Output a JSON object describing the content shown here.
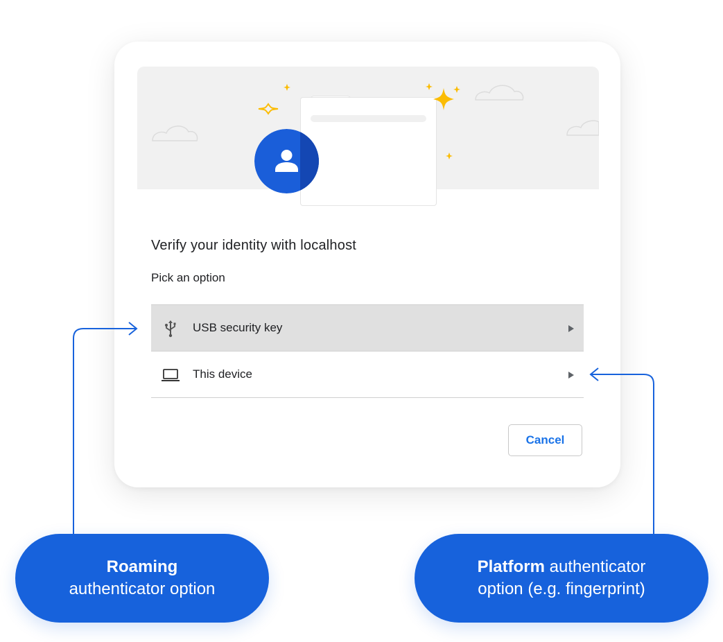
{
  "dialog": {
    "title": "Verify your identity with localhost",
    "subtitle": "Pick an option",
    "options": [
      {
        "label": "USB security key",
        "icon": "usb-icon",
        "highlighted": true
      },
      {
        "label": "This device",
        "icon": "laptop-icon",
        "highlighted": false
      }
    ],
    "cancel_label": "Cancel"
  },
  "callouts": {
    "left": {
      "bold": "Roaming",
      "text": "authenticator option"
    },
    "right": {
      "bold": "Platform",
      "text_inline": " authenticator",
      "text": "option (e.g. fingerprint)"
    }
  },
  "colors": {
    "accent": "#1a73e8",
    "callout_blue": "#1762dc",
    "avatar_blue": "#1a5ed9",
    "sparkle": "#fbbc04",
    "highlight_row": "#e0e0e0"
  }
}
